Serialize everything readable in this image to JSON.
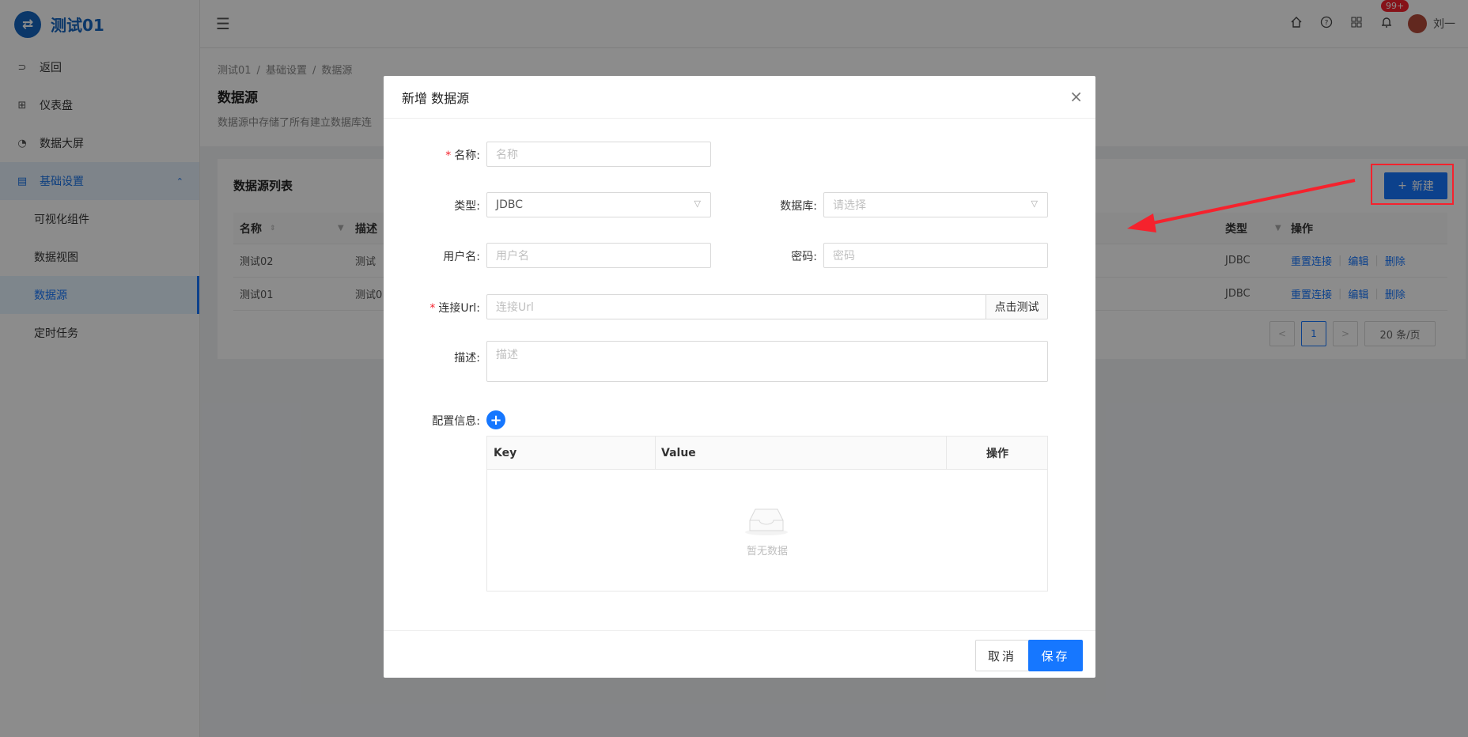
{
  "app": {
    "logo_glyph": "⇄",
    "title": "测试01"
  },
  "sidebar": {
    "items": [
      {
        "icon": "return-icon",
        "glyph": "⊃",
        "label": "返回"
      },
      {
        "icon": "dashboard-icon",
        "glyph": "⊞",
        "label": "仪表盘"
      },
      {
        "icon": "pie-chart-icon",
        "glyph": "◔",
        "label": "数据大屏"
      },
      {
        "icon": "book-icon",
        "glyph": "▤",
        "label": "基础设置",
        "chevron": "⌃"
      }
    ],
    "subitems": [
      "可视化组件",
      "数据视图",
      "数据源"
    ],
    "extra": "定时任务"
  },
  "header": {
    "collapse_glyph": "☰",
    "badge": "99+",
    "username": "刘一"
  },
  "page": {
    "breadcrumb": [
      "测试01",
      "基础设置",
      "数据源"
    ],
    "breadcrumb_sep": "/",
    "title": "数据源",
    "desc": "数据源中存储了所有建立数据库连"
  },
  "card": {
    "title": "数据源列表",
    "new_plus": "+",
    "new_label": "新建",
    "columns": {
      "name": "名称",
      "desc": "描述",
      "type": "类型",
      "ops": "操作"
    },
    "rows": [
      {
        "name": "测试02",
        "desc": "测试",
        "type": "JDBC"
      },
      {
        "name": "测试01",
        "desc": "测试0",
        "type": "JDBC"
      }
    ],
    "actions": [
      "重置连接",
      "编辑",
      "删除"
    ],
    "pager": {
      "prev": "<",
      "page": "1",
      "next": ">",
      "size": "20 条/页"
    }
  },
  "modal": {
    "title": "新增 数据源",
    "close": "×",
    "required_mark": "*",
    "name_label": "名称:",
    "name_placeholder": "名称",
    "type_label": "类型:",
    "type_value": "JDBC",
    "db_label": "数据库:",
    "db_placeholder": "请选择",
    "user_label": "用户名:",
    "user_placeholder": "用户名",
    "pwd_label": "密码:",
    "pwd_placeholder": "密码",
    "url_label": "连接Url:",
    "url_placeholder": "连接Url",
    "test_btn": "点击测试",
    "desc_label": "描述:",
    "desc_placeholder": "描述",
    "config_label": "配置信息:",
    "config_plus": "+",
    "kv_cols": [
      "Key",
      "Value",
      "操作"
    ],
    "empty_text": "暂无数据",
    "cancel": "取消",
    "save": "保存"
  },
  "colors": {
    "primary": "#1677ff",
    "danger": "#f5222d",
    "brand": "#1565c0"
  }
}
